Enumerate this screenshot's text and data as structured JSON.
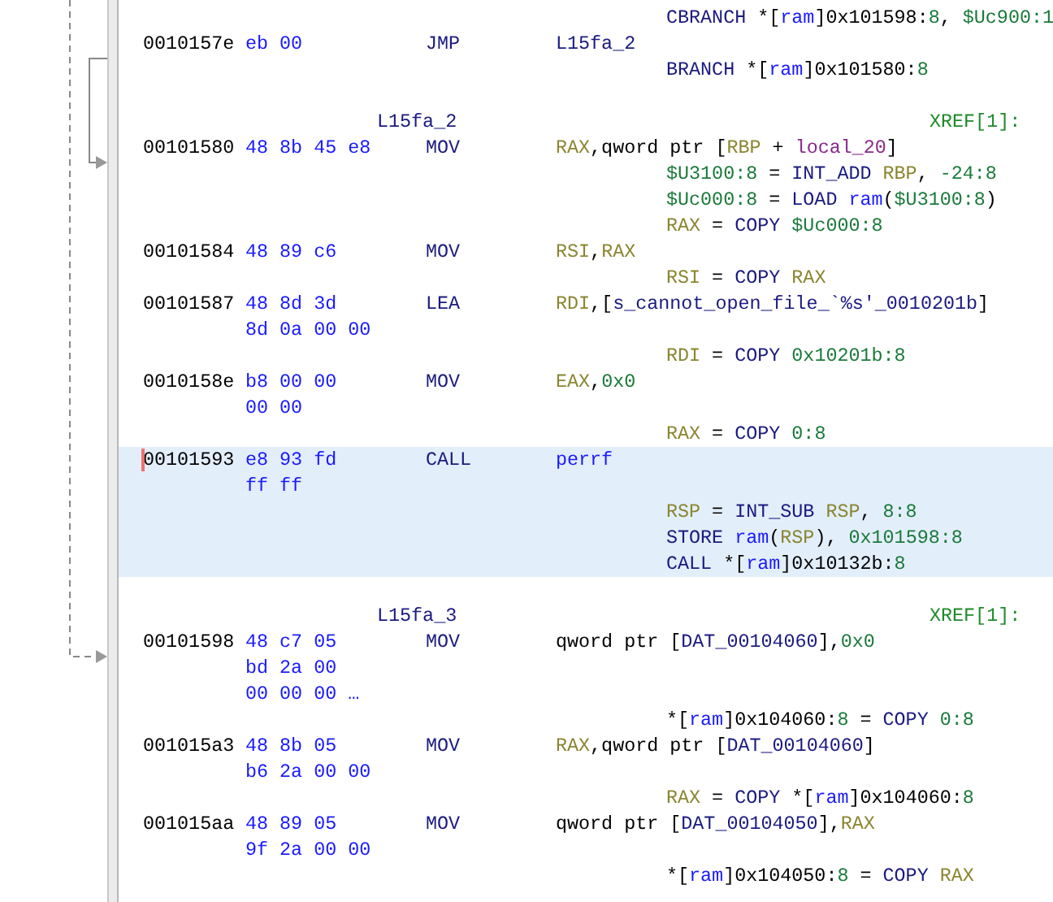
{
  "listing": {
    "lines": [
      {
        "kind": "pcode",
        "selected": false,
        "tokens": [
          {
            "text": "CBRANCH",
            "kind": "opcode"
          },
          {
            "text": " *[",
            "kind": "plain"
          },
          {
            "text": "ram",
            "kind": "space"
          },
          {
            "text": "]0x101598:",
            "kind": "plain"
          },
          {
            "text": "8",
            "kind": "num"
          },
          {
            "text": ", ",
            "kind": "plain"
          },
          {
            "text": "$Uc900:1",
            "kind": "num"
          }
        ]
      },
      {
        "kind": "instruction",
        "selected": false,
        "cursor": false,
        "address": "0010157e",
        "bytes": "eb 00",
        "mnemonic": "JMP",
        "tokens": [
          {
            "text": "L15fa_2",
            "kind": "name"
          }
        ]
      },
      {
        "kind": "pcode",
        "selected": false,
        "tokens": [
          {
            "text": "BRANCH",
            "kind": "opcode"
          },
          {
            "text": " *[",
            "kind": "plain"
          },
          {
            "text": "ram",
            "kind": "space"
          },
          {
            "text": "]0x101580:",
            "kind": "plain"
          },
          {
            "text": "8",
            "kind": "num"
          }
        ]
      },
      {
        "kind": "label",
        "selected": false,
        "label": "L15fa_2",
        "xref": "XREF[1]:"
      },
      {
        "kind": "instruction",
        "selected": false,
        "cursor": false,
        "address": "00101580",
        "bytes": "48 8b 45 e8",
        "mnemonic": "MOV",
        "tokens": [
          {
            "text": "RAX",
            "kind": "reg"
          },
          {
            "text": ",qword ptr [",
            "kind": "plain"
          },
          {
            "text": "RBP",
            "kind": "reg"
          },
          {
            "text": " + ",
            "kind": "plain"
          },
          {
            "text": "local_20",
            "kind": "local"
          },
          {
            "text": "]",
            "kind": "plain"
          }
        ]
      },
      {
        "kind": "pcode",
        "selected": false,
        "tokens": [
          {
            "text": "$U3100:8",
            "kind": "num"
          },
          {
            "text": " = ",
            "kind": "plain"
          },
          {
            "text": "INT_ADD ",
            "kind": "opcode"
          },
          {
            "text": "RBP",
            "kind": "reg"
          },
          {
            "text": ", ",
            "kind": "plain"
          },
          {
            "text": "-24:8",
            "kind": "num"
          }
        ]
      },
      {
        "kind": "pcode",
        "selected": false,
        "tokens": [
          {
            "text": "$Uc000:8",
            "kind": "num"
          },
          {
            "text": " = ",
            "kind": "plain"
          },
          {
            "text": "LOAD ",
            "kind": "opcode"
          },
          {
            "text": "ram",
            "kind": "space"
          },
          {
            "text": "(",
            "kind": "plain"
          },
          {
            "text": "$U3100:8",
            "kind": "num"
          },
          {
            "text": ")",
            "kind": "plain"
          }
        ]
      },
      {
        "kind": "pcode",
        "selected": false,
        "tokens": [
          {
            "text": "RAX",
            "kind": "reg"
          },
          {
            "text": " = ",
            "kind": "plain"
          },
          {
            "text": "COPY ",
            "kind": "opcode"
          },
          {
            "text": "$Uc000:8",
            "kind": "num"
          }
        ]
      },
      {
        "kind": "instruction",
        "selected": false,
        "cursor": false,
        "address": "00101584",
        "bytes": "48 89 c6",
        "mnemonic": "MOV",
        "tokens": [
          {
            "text": "RSI",
            "kind": "reg"
          },
          {
            "text": ",",
            "kind": "plain"
          },
          {
            "text": "RAX",
            "kind": "reg"
          }
        ]
      },
      {
        "kind": "pcode",
        "selected": false,
        "tokens": [
          {
            "text": "RSI",
            "kind": "reg"
          },
          {
            "text": " = ",
            "kind": "plain"
          },
          {
            "text": "COPY ",
            "kind": "opcode"
          },
          {
            "text": "RAX",
            "kind": "reg"
          }
        ]
      },
      {
        "kind": "instruction",
        "selected": false,
        "cursor": false,
        "address": "00101587",
        "bytes": "48 8d 3d",
        "mnemonic": "LEA",
        "tokens": [
          {
            "text": "RDI",
            "kind": "reg"
          },
          {
            "text": ",[",
            "kind": "plain"
          },
          {
            "text": "s_cannot_open_file_`%s'_0010201b",
            "kind": "name"
          },
          {
            "text": "]",
            "kind": "plain"
          }
        ]
      },
      {
        "kind": "bytes",
        "selected": false,
        "bytes": "8d 0a 00 00"
      },
      {
        "kind": "pcode",
        "selected": false,
        "tokens": [
          {
            "text": "RDI",
            "kind": "reg"
          },
          {
            "text": " = ",
            "kind": "plain"
          },
          {
            "text": "COPY ",
            "kind": "opcode"
          },
          {
            "text": "0x10201b:8",
            "kind": "num"
          }
        ]
      },
      {
        "kind": "instruction",
        "selected": false,
        "cursor": false,
        "address": "0010158e",
        "bytes": "b8 00 00",
        "mnemonic": "MOV",
        "tokens": [
          {
            "text": "EAX",
            "kind": "reg"
          },
          {
            "text": ",",
            "kind": "plain"
          },
          {
            "text": "0x0",
            "kind": "num"
          }
        ]
      },
      {
        "kind": "bytes",
        "selected": false,
        "bytes": "00 00"
      },
      {
        "kind": "pcode",
        "selected": false,
        "tokens": [
          {
            "text": "RAX",
            "kind": "reg"
          },
          {
            "text": " = ",
            "kind": "plain"
          },
          {
            "text": "COPY ",
            "kind": "opcode"
          },
          {
            "text": "0:8",
            "kind": "num"
          }
        ]
      },
      {
        "kind": "instruction",
        "selected": true,
        "cursor": true,
        "address": "00101593",
        "bytes": "e8 93 fd",
        "mnemonic": "CALL",
        "tokens": [
          {
            "text": "perrf",
            "kind": "space"
          }
        ]
      },
      {
        "kind": "bytes",
        "selected": true,
        "bytes": "ff ff"
      },
      {
        "kind": "pcode",
        "selected": true,
        "tokens": [
          {
            "text": "RSP",
            "kind": "reg"
          },
          {
            "text": " = ",
            "kind": "plain"
          },
          {
            "text": "INT_SUB ",
            "kind": "opcode"
          },
          {
            "text": "RSP",
            "kind": "reg"
          },
          {
            "text": ", ",
            "kind": "plain"
          },
          {
            "text": "8:8",
            "kind": "num"
          }
        ]
      },
      {
        "kind": "pcode",
        "selected": true,
        "tokens": [
          {
            "text": "STORE ",
            "kind": "opcode"
          },
          {
            "text": "ram",
            "kind": "space"
          },
          {
            "text": "(",
            "kind": "plain"
          },
          {
            "text": "RSP",
            "kind": "reg"
          },
          {
            "text": "), ",
            "kind": "plain"
          },
          {
            "text": "0x101598:8",
            "kind": "num"
          }
        ]
      },
      {
        "kind": "pcode",
        "selected": true,
        "tokens": [
          {
            "text": "CALL",
            "kind": "opcode"
          },
          {
            "text": " *[",
            "kind": "plain"
          },
          {
            "text": "ram",
            "kind": "space"
          },
          {
            "text": "]0x10132b:",
            "kind": "plain"
          },
          {
            "text": "8",
            "kind": "num"
          }
        ]
      },
      {
        "kind": "label",
        "selected": false,
        "label": "L15fa_3",
        "xref": "XREF[1]:"
      },
      {
        "kind": "instruction",
        "selected": false,
        "cursor": false,
        "address": "00101598",
        "bytes": "48 c7 05",
        "mnemonic": "MOV",
        "tokens": [
          {
            "text": "qword ptr [",
            "kind": "plain"
          },
          {
            "text": "DAT_00104060",
            "kind": "name"
          },
          {
            "text": "],",
            "kind": "plain"
          },
          {
            "text": "0x0",
            "kind": "num"
          }
        ]
      },
      {
        "kind": "bytes",
        "selected": false,
        "bytes": "bd 2a 00"
      },
      {
        "kind": "bytes",
        "selected": false,
        "bytes": "00 00 00 …"
      },
      {
        "kind": "pcode",
        "selected": false,
        "tokens": [
          {
            "text": "*[",
            "kind": "plain"
          },
          {
            "text": "ram",
            "kind": "space"
          },
          {
            "text": "]0x104060:",
            "kind": "plain"
          },
          {
            "text": "8",
            "kind": "num"
          },
          {
            "text": " = ",
            "kind": "plain"
          },
          {
            "text": "COPY ",
            "kind": "opcode"
          },
          {
            "text": "0:8",
            "kind": "num"
          }
        ]
      },
      {
        "kind": "instruction",
        "selected": false,
        "cursor": false,
        "address": "001015a3",
        "bytes": "48 8b 05",
        "mnemonic": "MOV",
        "tokens": [
          {
            "text": "RAX",
            "kind": "reg"
          },
          {
            "text": ",qword ptr [",
            "kind": "plain"
          },
          {
            "text": "DAT_00104060",
            "kind": "name"
          },
          {
            "text": "]",
            "kind": "plain"
          }
        ]
      },
      {
        "kind": "bytes",
        "selected": false,
        "bytes": "b6 2a 00 00"
      },
      {
        "kind": "pcode",
        "selected": false,
        "tokens": [
          {
            "text": "RAX",
            "kind": "reg"
          },
          {
            "text": " = ",
            "kind": "plain"
          },
          {
            "text": "COPY",
            "kind": "opcode"
          },
          {
            "text": " *[",
            "kind": "plain"
          },
          {
            "text": "ram",
            "kind": "space"
          },
          {
            "text": "]0x104060:",
            "kind": "plain"
          },
          {
            "text": "8",
            "kind": "num"
          }
        ]
      },
      {
        "kind": "instruction",
        "selected": false,
        "cursor": false,
        "address": "001015aa",
        "bytes": "48 89 05",
        "mnemonic": "MOV",
        "tokens": [
          {
            "text": "qword ptr [",
            "kind": "plain"
          },
          {
            "text": "DAT_00104050",
            "kind": "name"
          },
          {
            "text": "],",
            "kind": "plain"
          },
          {
            "text": "RAX",
            "kind": "reg"
          }
        ]
      },
      {
        "kind": "bytes",
        "selected": false,
        "bytes": "9f 2a 00 00"
      },
      {
        "kind": "pcode",
        "selected": false,
        "tokens": [
          {
            "text": "*[",
            "kind": "plain"
          },
          {
            "text": "ram",
            "kind": "space"
          },
          {
            "text": "]0x104050:",
            "kind": "plain"
          },
          {
            "text": "8",
            "kind": "num"
          },
          {
            "text": " = ",
            "kind": "plain"
          },
          {
            "text": "COPY ",
            "kind": "opcode"
          },
          {
            "text": "RAX",
            "kind": "reg"
          }
        ]
      }
    ]
  }
}
